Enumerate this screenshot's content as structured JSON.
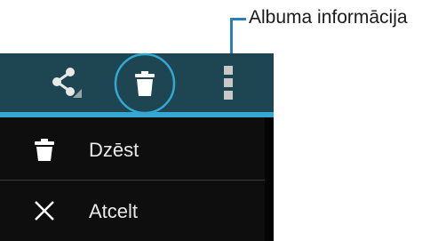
{
  "callout": {
    "label": "Albuma informācija"
  },
  "toolbar": {
    "background_color": "#1e4552",
    "accent_color": "#35a7d3",
    "actions": [
      {
        "name": "share",
        "icon": "share-icon"
      },
      {
        "name": "delete",
        "icon": "trash-icon",
        "highlighted": true
      },
      {
        "name": "more",
        "icon": "more-vertical-icon"
      }
    ]
  },
  "menu": {
    "items": [
      {
        "label": "Dzēst",
        "icon": "trash-icon"
      },
      {
        "label": "Atcelt",
        "icon": "close-icon"
      }
    ]
  }
}
